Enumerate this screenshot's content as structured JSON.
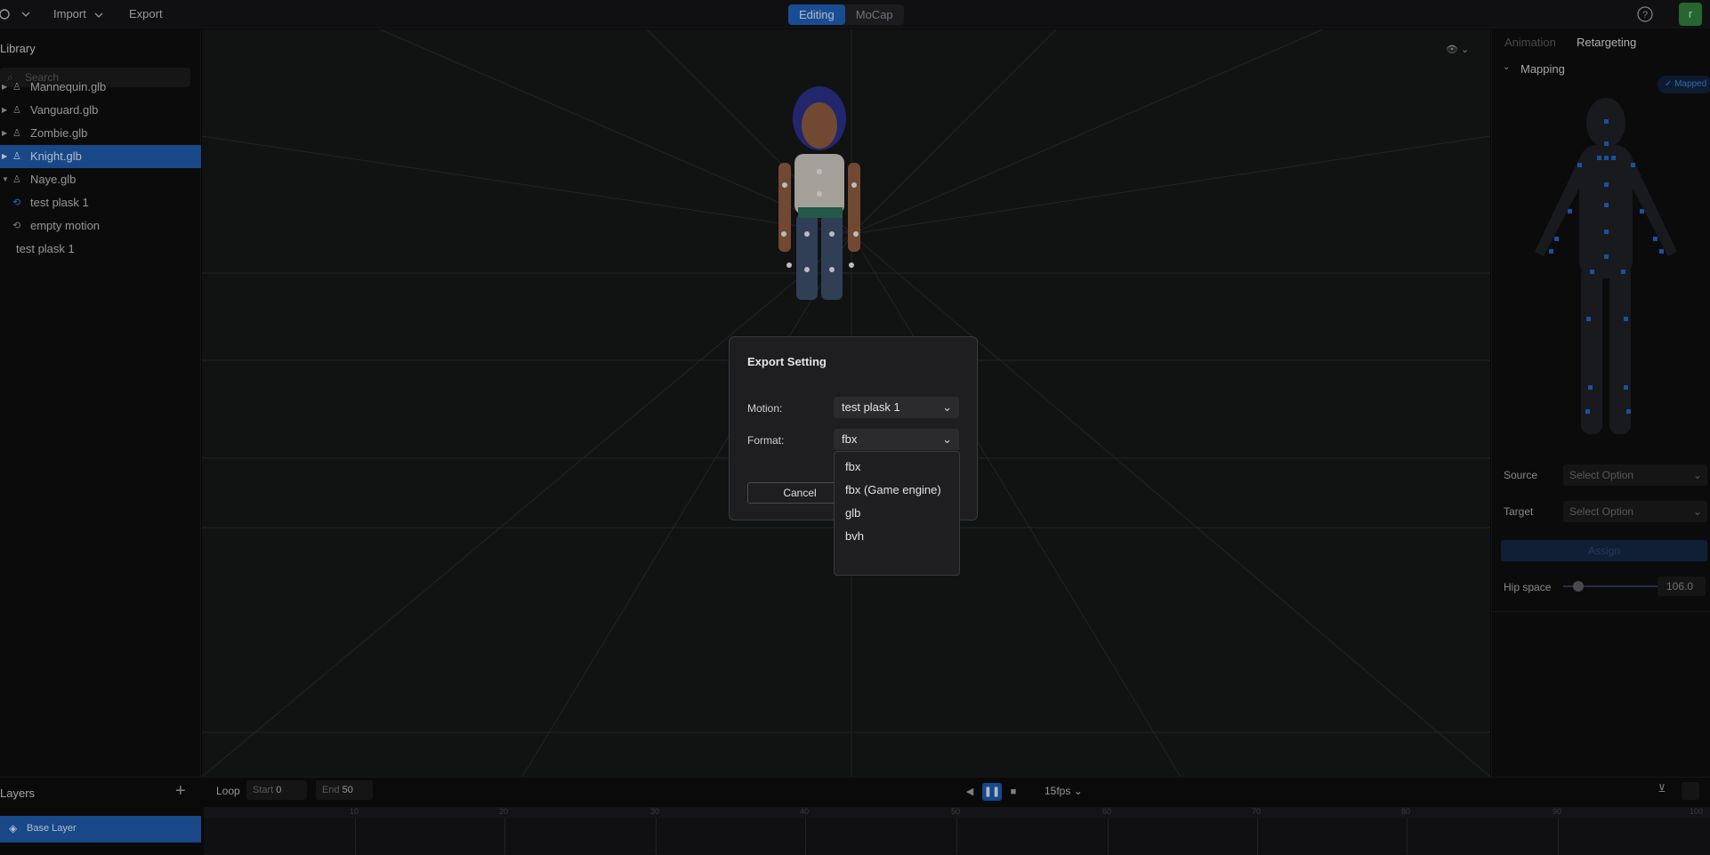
{
  "topbar": {
    "import_label": "Import",
    "export_label": "Export",
    "modes": [
      "Editing",
      "MoCap"
    ],
    "avatar_letter": "r"
  },
  "library": {
    "title": "Library",
    "search_placeholder": "Search",
    "items": [
      {
        "label": "Mannequin.glb"
      },
      {
        "label": "Vanguard.glb"
      },
      {
        "label": "Zombie.glb"
      },
      {
        "label": "Knight.glb"
      },
      {
        "label": "Naye.glb"
      },
      {
        "label": "test plask 1"
      },
      {
        "label": "empty motion"
      },
      {
        "label": "test plask 1"
      }
    ]
  },
  "right_panel": {
    "tabs": [
      "Animation",
      "Retargeting"
    ],
    "mapping_label": "Mapping",
    "mapped_chip": "Mapped",
    "source_label": "Source",
    "target_label": "Target",
    "source_placeholder": "Select Option",
    "target_placeholder": "Select Option",
    "assign_label": "Assign",
    "hip_space_label": "Hip space",
    "hip_space_value": "106.0"
  },
  "bottom": {
    "layers_label": "Layers",
    "base_layer_label": "Base Layer",
    "loop_label": "Loop",
    "start_label": "Start",
    "start_value": "0",
    "end_label": "End",
    "end_value": "50",
    "fps_label": "15fps",
    "ruler_ticks": [
      "10",
      "20",
      "30",
      "40",
      "50",
      "60",
      "70",
      "80",
      "90",
      "100"
    ]
  },
  "dialog": {
    "title": "Export Setting",
    "motion_label": "Motion:",
    "motion_value": "test plask 1",
    "format_label": "Format:",
    "format_value": "fbx",
    "cancel_label": "Cancel",
    "format_options": [
      "fbx",
      "fbx (Game engine)",
      "glb",
      "bvh"
    ]
  },
  "colors": {
    "accent": "#1e58a6",
    "bone_dot": "#2a6fd6"
  }
}
